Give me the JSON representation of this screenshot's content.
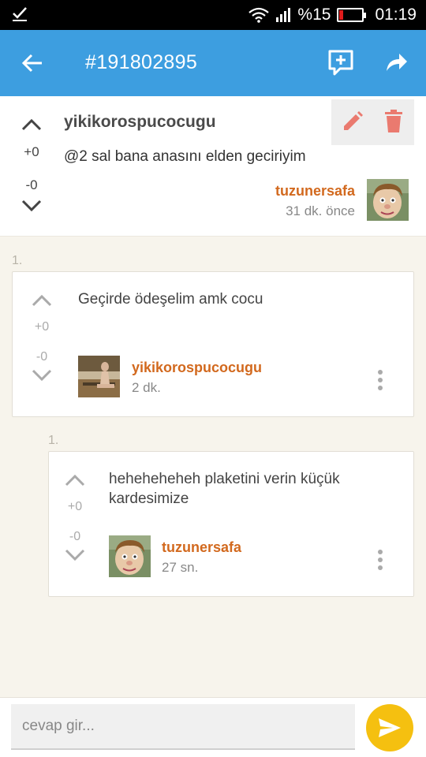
{
  "status_bar": {
    "battery": "%15",
    "battery_level": 0.15,
    "time": "01:19",
    "icons": [
      "check-icon",
      "wifi-icon",
      "signal-icon",
      "battery-icon"
    ]
  },
  "app_bar": {
    "title": "#191802895",
    "icons": [
      "back-arrow-icon",
      "add-comment-icon",
      "share-icon"
    ]
  },
  "post": {
    "upvotes": "+0",
    "downvotes": "-0",
    "username": "yikikorospucocugu",
    "body": "@2 sal bana anasını elden geciriyim",
    "author": "tuzunersafa",
    "time": "31 dk. önce",
    "action_icons": [
      "edit-icon",
      "delete-icon"
    ]
  },
  "comments": [
    {
      "index": "1.",
      "upvotes": "+0",
      "downvotes": "-0",
      "text": "Geçirde ödeşelim amk cocu",
      "author": "yikikorospucocugu",
      "time": "2 dk."
    },
    {
      "index": "1.",
      "upvotes": "+0",
      "downvotes": "-0",
      "text": "heheheheheh plaketini verin küçük kardesimize",
      "author": "tuzunersafa",
      "time": "27 sn."
    }
  ],
  "reply": {
    "placeholder": "cevap gir...",
    "send_icon": "send-icon"
  },
  "colors": {
    "app_bar": "#3d9ee0",
    "author": "#d2691e",
    "action_icon": "#ea7a6f",
    "send": "#f5c010",
    "background": "#f7f4ec"
  }
}
